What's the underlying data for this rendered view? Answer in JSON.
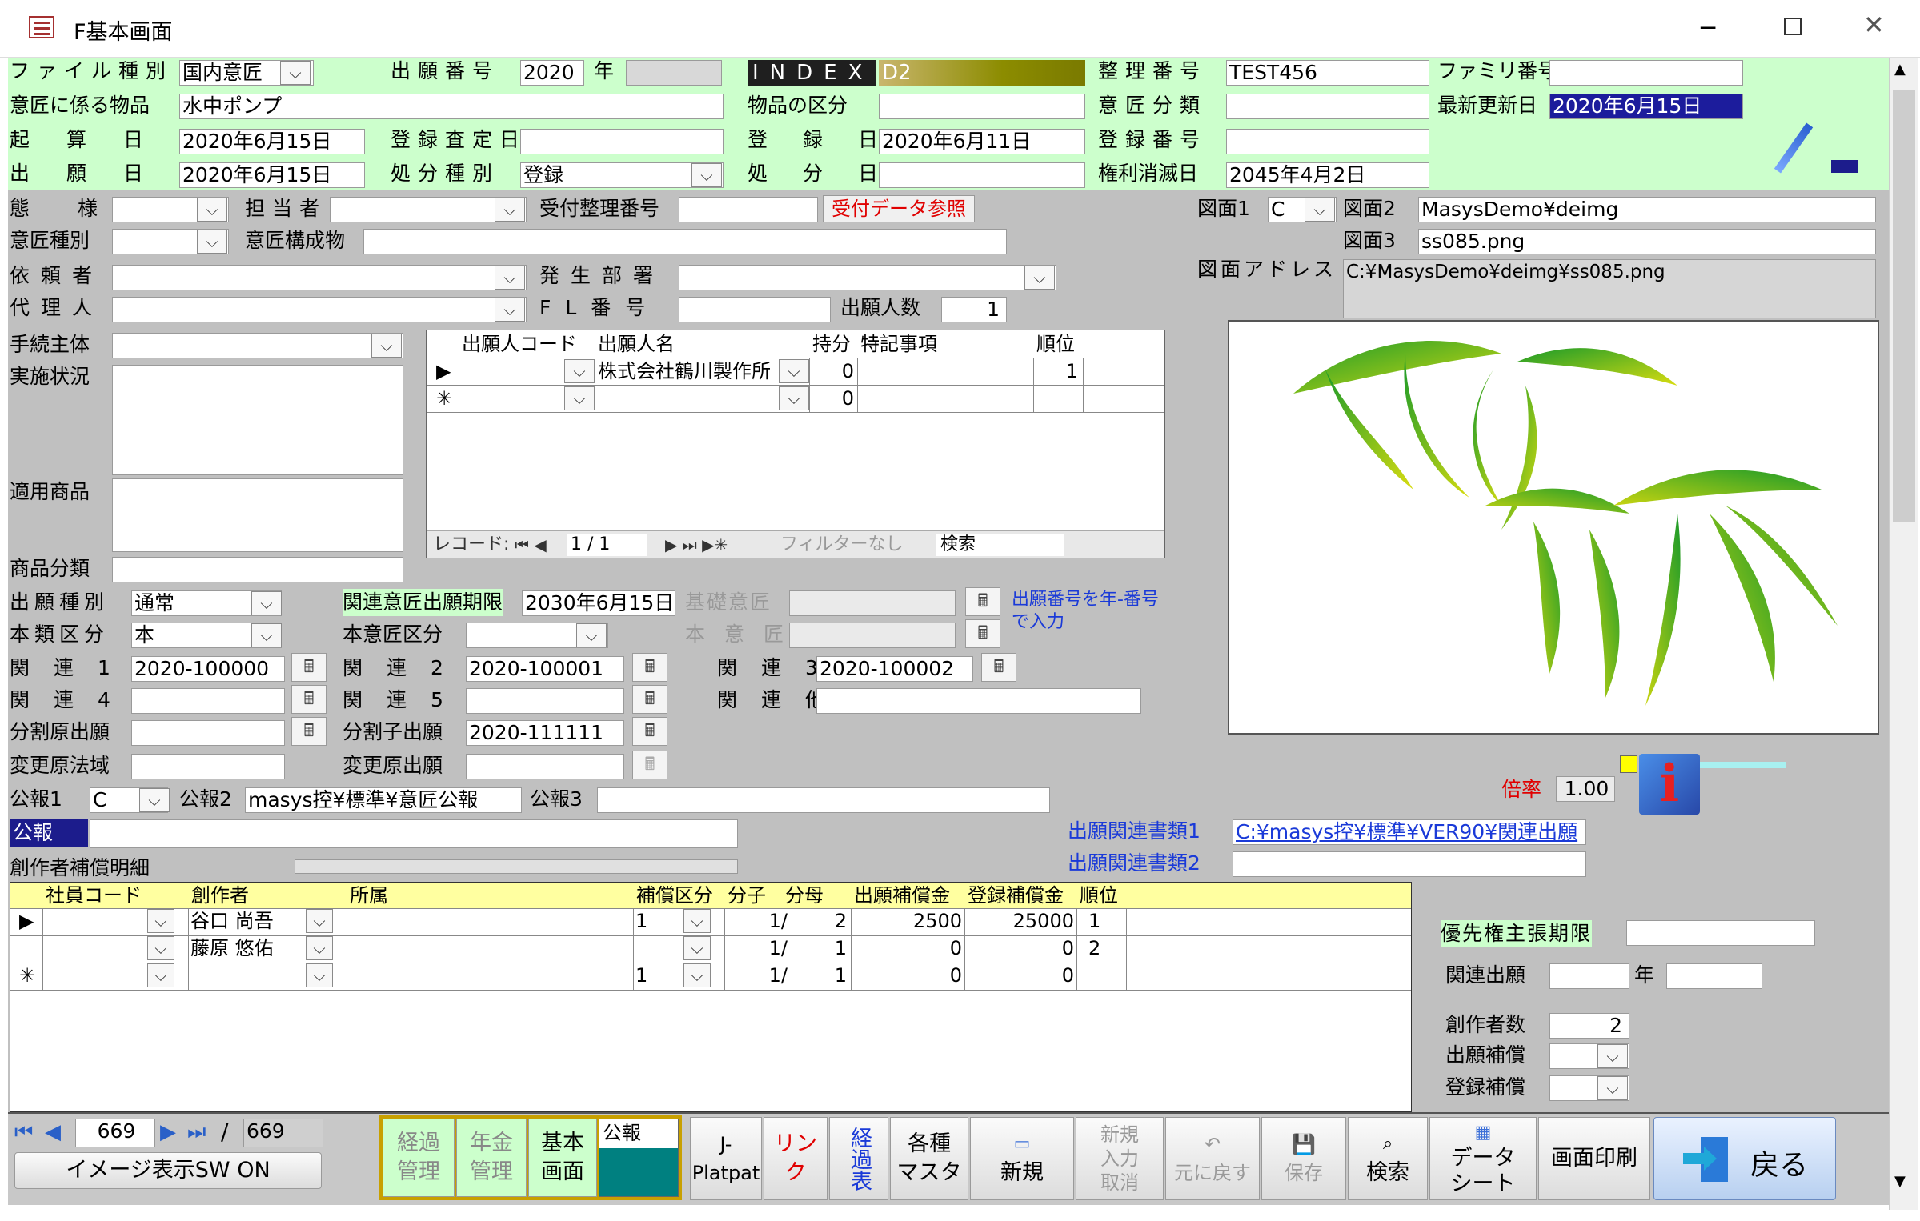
{
  "window": {
    "title": "F基本画面"
  },
  "header": {
    "file_type": {
      "label": "ファイル種別",
      "value": "国内意匠"
    },
    "app_no": {
      "label": "出願番号",
      "year_value": "2020",
      "year_unit": "年"
    },
    "index": {
      "label": "INDEX",
      "value": "D2"
    },
    "seiri": {
      "label": "整理番号",
      "value": "TEST456"
    },
    "family": {
      "label": "ファミリ番号",
      "value": ""
    },
    "article": {
      "label": "意匠に係る物品",
      "value": "水中ポンプ"
    },
    "article_class": {
      "label": "物品の区分",
      "value": ""
    },
    "design_class": {
      "label": "意匠分類",
      "value": ""
    },
    "last_update": {
      "label": "最新更新日",
      "value": "2020年6月15日"
    },
    "kisan": {
      "label": "起算日",
      "value": "2020年6月15日"
    },
    "reg_exam": {
      "label": "登録査定日",
      "value": ""
    },
    "reg_date": {
      "label": "登録日",
      "value": "2020年6月11日"
    },
    "reg_no": {
      "label": "登録番号",
      "value": ""
    },
    "filing_date": {
      "label": "出願日",
      "value": "2020年6月15日"
    },
    "disposal_type": {
      "label": "処分種別",
      "value": "登録"
    },
    "disposal_date": {
      "label": "処分日",
      "value": ""
    },
    "expire_date": {
      "label": "権利消滅日",
      "value": "2045年4月2日"
    }
  },
  "left": {
    "mode": {
      "label": "態様"
    },
    "person": {
      "label": "担当者"
    },
    "reception_no": {
      "label": "受付整理番号"
    },
    "reception_btn": "受付データ参照",
    "design_kind": {
      "label": "意匠種別"
    },
    "design_comp": {
      "label": "意匠構成物"
    },
    "client": {
      "label": "依頼者"
    },
    "dept": {
      "label": "発生部署"
    },
    "agent": {
      "label": "代理人"
    },
    "fl_no": {
      "label": "FL番号"
    },
    "applicant_count": {
      "label": "出願人数",
      "value": "1"
    },
    "procedure": {
      "label": "手続主体"
    },
    "status": {
      "label": "実施状況"
    },
    "goods": {
      "label": "適用商品"
    },
    "goods_class": {
      "label": "商品分類"
    },
    "app_kind": {
      "label": "出願種別",
      "value": "通常"
    },
    "main_kind": {
      "label": "本類区分",
      "value": "本"
    },
    "related_deadline": {
      "label": "関連意匠出願期限",
      "value": "2030年6月15日"
    },
    "base_design": {
      "label": "基礎意匠"
    },
    "main_design": {
      "label": "本意匠"
    },
    "main_design_kind": {
      "label": "本意匠区分"
    },
    "hint": "出願番号を年-番号で入力",
    "rel1": {
      "label": "関連1",
      "value": "2020-100000"
    },
    "rel2": {
      "label": "関連2",
      "value": "2020-100001"
    },
    "rel3": {
      "label": "関連3",
      "value": "2020-100002"
    },
    "rel4": {
      "label": "関連4",
      "value": ""
    },
    "rel5": {
      "label": "関連5",
      "value": ""
    },
    "rel_other": {
      "label": "関連他",
      "value": ""
    },
    "div_parent": {
      "label": "分割原出願",
      "value": ""
    },
    "div_child": {
      "label": "分割子出願",
      "value": "2020-111111"
    },
    "chg_law": {
      "label": "変更原法域",
      "value": ""
    },
    "chg_app": {
      "label": "変更原出願",
      "value": ""
    },
    "gazette1": {
      "label": "公報1",
      "value": "C"
    },
    "gazette2": {
      "label": "公報2",
      "value": "masys控¥標準¥意匠公報"
    },
    "gazette3": {
      "label": "公報3",
      "value": ""
    },
    "gazette": {
      "label": "公報",
      "value": ""
    }
  },
  "applicants": {
    "headers": [
      "出願人コード",
      "出願人名",
      "持分",
      "特記事項",
      "順位"
    ],
    "rows": [
      {
        "marker": "▶",
        "code": "",
        "name": "株式会社鶴川製作所",
        "share": "0",
        "note": "",
        "rank": "1"
      },
      {
        "marker": "✳",
        "code": "",
        "name": "",
        "share": "0",
        "note": "",
        "rank": ""
      }
    ],
    "nav": {
      "label": "レコード:",
      "pos": "1 / 1",
      "filter": "フィルターなし",
      "search": "検索"
    }
  },
  "figures": {
    "fig1": {
      "label": "図面1",
      "value": "C"
    },
    "fig2": {
      "label": "図面2",
      "value": "MasysDemo¥deimg"
    },
    "fig3": {
      "label": "図面3",
      "value": "ss085.png"
    },
    "address": {
      "label": "図面アドレス",
      "value": "C:¥MasysDemo¥deimg¥ss085.png"
    },
    "zoom": {
      "label": "倍率",
      "value": "1.00"
    }
  },
  "docs": {
    "doc1": {
      "label": "出願関連書類1",
      "value": "C:¥masys控¥標準¥VER90¥関連出願"
    },
    "doc2": {
      "label": "出願関連書類2",
      "value": ""
    }
  },
  "creators": {
    "title": "創作者補償明細",
    "headers": [
      "社員コード",
      "創作者",
      "所属",
      "補償区分",
      "分子",
      "分母",
      "出願補償金",
      "登録補償金",
      "順位"
    ],
    "rows": [
      {
        "marker": "▶",
        "code": "",
        "name": "谷口 尚吾",
        "dept": "",
        "kind": "1",
        "num": "1/",
        "den": "2",
        "app_comp": "2500",
        "reg_comp": "25000",
        "rank": "1"
      },
      {
        "marker": "",
        "code": "",
        "name": "藤原 悠佑",
        "dept": "",
        "kind": "",
        "num": "1/",
        "den": "1",
        "app_comp": "0",
        "reg_comp": "0",
        "rank": "2"
      },
      {
        "marker": "✳",
        "code": "",
        "name": "",
        "dept": "",
        "kind": "1",
        "num": "1/",
        "den": "1",
        "app_comp": "0",
        "reg_comp": "0",
        "rank": ""
      }
    ]
  },
  "right_panel": {
    "priority": {
      "label": "優先権主張期限",
      "value": ""
    },
    "related_app": {
      "label": "関連出願",
      "year": "年"
    },
    "creator_count": {
      "label": "創作者数",
      "value": "2"
    },
    "app_comp": {
      "label": "出願補償"
    },
    "reg_comp": {
      "label": "登録補償"
    }
  },
  "bottom": {
    "record_current": "669",
    "record_sep": "/",
    "record_total": "669",
    "image_sw": "イメージ表示SW ON",
    "tabs": [
      {
        "l1": "経過",
        "l2": "管理"
      },
      {
        "l1": "年金",
        "l2": "管理"
      },
      {
        "l1": "基本",
        "l2": "画面"
      }
    ],
    "gazette_tab": "公報",
    "buttons": {
      "jplat1": "J-",
      "jplat2": "Platpat",
      "link": "リンク",
      "keika": "経過表",
      "masters1": "各種",
      "masters2": "マスタ",
      "new": "新規",
      "cancel1": "新規",
      "cancel2": "入力",
      "cancel3": "取消",
      "undo": "元に戻す",
      "save": "保存",
      "search": "検索",
      "datasheet1": "データ",
      "datasheet2": "シート",
      "print": "画面印刷",
      "back": "戻る"
    }
  },
  "colors": {
    "header_bg": "#ccffcc",
    "body_bg": "#c0c0c0",
    "index_bg": "#1f1f1f",
    "index_value_bg": "#8c8c00",
    "selected_bg": "#1c1c9c",
    "grid_header_bg": "#ffffa0",
    "tab_bg": "#ccffcc",
    "gazette_tab_bg": "#008080",
    "accent_blue": "#3b5bd6",
    "red": "#e00000"
  }
}
